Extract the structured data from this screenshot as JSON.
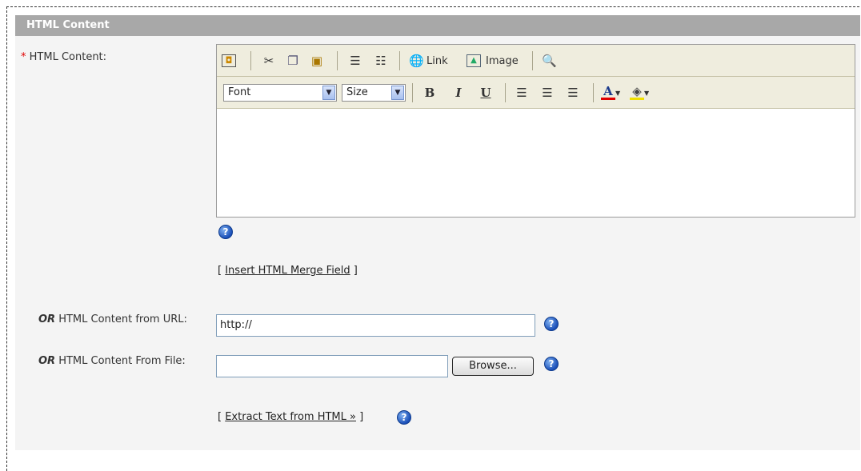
{
  "section": {
    "title": "HTML Content"
  },
  "html_content": {
    "required_marker": "*",
    "label": "HTML Content:",
    "toolbar1": {
      "link_label": "Link",
      "image_label": "Image",
      "icons": [
        "source-icon",
        "cut-icon",
        "copy-icon",
        "paste-icon",
        "ordered-list-icon",
        "unordered-list-icon",
        "link-icon",
        "image-icon",
        "preview-icon"
      ]
    },
    "toolbar2": {
      "font_select": "Font",
      "size_select": "Size",
      "bold": "B",
      "italic": "I",
      "underline": "U",
      "icons": [
        "align-left-icon",
        "align-center-icon",
        "align-right-icon",
        "text-color-icon",
        "background-color-icon"
      ]
    },
    "merge_field_prefix": "[ ",
    "merge_field_link": "Insert HTML Merge Field",
    "merge_field_suffix": " ]"
  },
  "url_field": {
    "or_word": "OR",
    "label": " HTML Content from URL:",
    "value": "http://"
  },
  "file_field": {
    "or_word": "OR",
    "label": " HTML Content From File:",
    "value": "",
    "browse_label": "Browse..."
  },
  "extract": {
    "prefix": "[ ",
    "link": "Extract Text from HTML »",
    "suffix": " ]"
  },
  "help_glyph": "?"
}
